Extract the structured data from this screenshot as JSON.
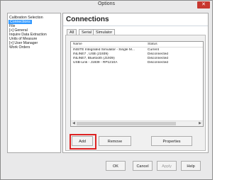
{
  "window": {
    "title": "Options",
    "close_label": "✕"
  },
  "sidebar": {
    "items": [
      {
        "label": "Calibration Selection",
        "prefix": ""
      },
      {
        "label": "Connections",
        "prefix": ""
      },
      {
        "label": "File",
        "prefix": ""
      },
      {
        "label": "General",
        "prefix": "[+]"
      },
      {
        "label": "Inquire Data Extraction",
        "prefix": ""
      },
      {
        "label": "Units of Measure",
        "prefix": ""
      },
      {
        "label": "User Manager",
        "prefix": "[+]"
      },
      {
        "label": "Work Orders",
        "prefix": ""
      }
    ],
    "selected_index": 1
  },
  "panel": {
    "title": "Connections",
    "tabs": [
      {
        "label": "All"
      },
      {
        "label": "Serial"
      },
      {
        "label": "Simulator"
      }
    ],
    "active_tab": 0,
    "list": {
      "columns": [
        "Name",
        "Status"
      ],
      "rows": [
        [
          "INSITE Integrated Simulator - Single M...",
          "Current"
        ],
        [
          "INLINE7 , USB (J1939)",
          "Disconnected"
        ],
        [
          "INLINE7, Bluetooth (J1939)",
          "Disconnected"
        ],
        [
          "USB-Link - J1939 - RP1210A",
          "Disconnected"
        ]
      ]
    },
    "buttons": {
      "add": "Add",
      "remove": "Remove",
      "properties": "Properties"
    }
  },
  "footer": {
    "ok": "OK",
    "cancel": "Cancel",
    "apply": "Apply",
    "help": "Help"
  },
  "colors": {
    "selection": "#3399ff",
    "highlight_box": "#dd2222",
    "close_button": "#c7372f"
  }
}
